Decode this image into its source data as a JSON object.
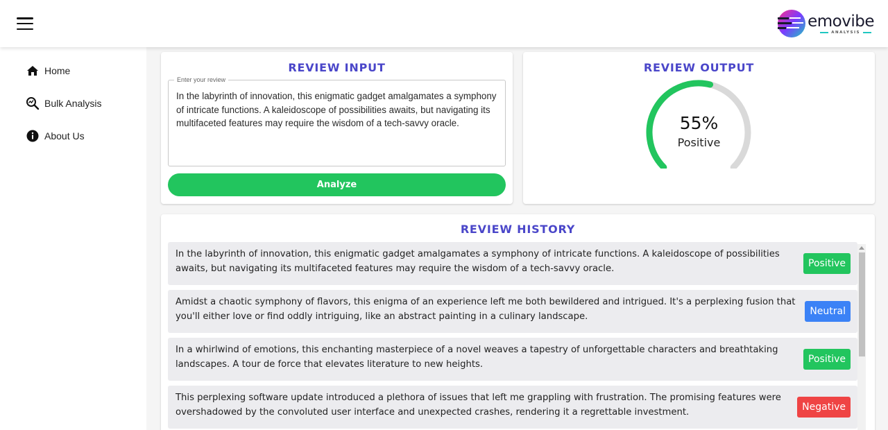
{
  "header": {
    "logo_name": "emovibe",
    "logo_sub": "ANALYSIS"
  },
  "sidebar": {
    "items": [
      {
        "label": "Home",
        "icon": "home-icon"
      },
      {
        "label": "Bulk Analysis",
        "icon": "bulk-analysis-icon"
      },
      {
        "label": "About Us",
        "icon": "info-icon"
      }
    ]
  },
  "input_card": {
    "title": "REVIEW INPUT",
    "field_label": "Enter your review",
    "review_text": "In the labyrinth of innovation, this enigmatic gadget amalgamates a symphony of intricate functions. A kaleidoscope of possibilities awaits, but navigating its multifaceted features may require the wisdom of a tech-savvy oracle.",
    "analyze_label": "Analyze"
  },
  "output_card": {
    "title": "REVIEW OUTPUT",
    "percent_text": "55%",
    "percent_value": 55,
    "sentiment": "Positive",
    "gauge_color": "#22c55e",
    "gauge_track_color": "#d9d9d9"
  },
  "history": {
    "title": "REVIEW HISTORY",
    "rows": [
      {
        "text": "In the labyrinth of innovation, this enigmatic gadget amalgamates a symphony of intricate functions. A kaleidoscope of possibilities awaits, but navigating its multifaceted features may require the wisdom of a tech-savvy oracle.",
        "label": "Positive"
      },
      {
        "text": "Amidst a chaotic symphony of flavors, this enigma of an experience left me both bewildered and intrigued. It's a perplexing fusion that you'll either love or find oddly intriguing, like an abstract painting in a culinary landscape.",
        "label": "Neutral"
      },
      {
        "text": "In a whirlwind of emotions, this enchanting masterpiece of a novel weaves a tapestry of unforgettable characters and breathtaking landscapes. A tour de force that elevates literature to new heights.",
        "label": "Positive"
      },
      {
        "text": "This perplexing software update introduced a plethora of issues that left me grappling with frustration. The promising features were overshadowed by the convoluted user interface and unexpected crashes, rendering it a regrettable investment.",
        "label": "Negative"
      }
    ]
  },
  "colors": {
    "title_accent": "#4a46c9",
    "positive": "#22c55e",
    "neutral": "#3b82f6",
    "negative": "#ef4444"
  }
}
